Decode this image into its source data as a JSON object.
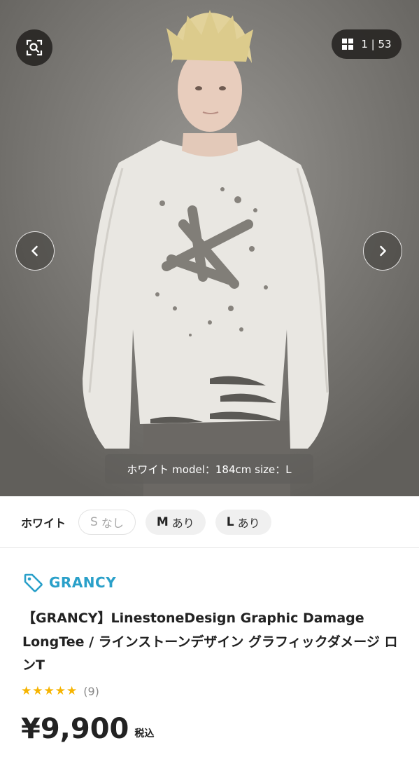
{
  "gallery": {
    "counter": "1 | 53",
    "caption": "ホワイト model：184cm size：L",
    "icons": {
      "lens": "image-search-icon",
      "grid": "grid-icon",
      "prev": "chevron-left-icon",
      "next": "chevron-right-icon"
    }
  },
  "variants": {
    "color": "ホワイト",
    "sizes": [
      {
        "size": "S",
        "stock": "なし",
        "available": false
      },
      {
        "size": "M",
        "stock": "あり",
        "available": true
      },
      {
        "size": "L",
        "stock": "あり",
        "available": true
      }
    ]
  },
  "product": {
    "brand": "GRANCY",
    "brand_icon": "tag-icon",
    "title": "【GRANCY】LinestoneDesign Graphic Damage LongTee / ラインストーンデザイン グラフィックダメージ ロンT",
    "rating": 5,
    "review_count": "(9)",
    "price": "¥9,900",
    "tax_label": "税込"
  },
  "colors": {
    "brand": "#2aa0c9",
    "star": "#f6b400",
    "text": "#222222"
  }
}
